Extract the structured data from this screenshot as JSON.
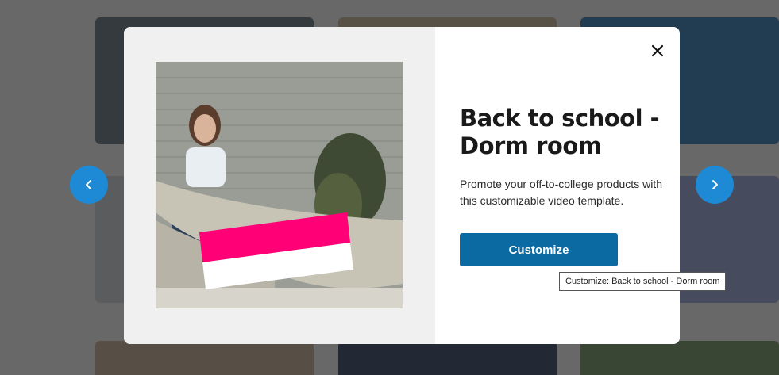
{
  "modal": {
    "title": "Back to school - Dorm room",
    "description": "Promote your off-to-college products with this customizable video template.",
    "customize_label": "Customize",
    "close_icon": "close-icon"
  },
  "navigation": {
    "prev_icon": "chevron-left-icon",
    "next_icon": "chevron-right-icon"
  },
  "tooltip": {
    "text": "Customize: Back to school - Dorm room"
  },
  "colors": {
    "primary_button": "#0a6aa1",
    "nav_button": "#1e8ad6",
    "overlay_banner_pink": "#ff0077"
  }
}
